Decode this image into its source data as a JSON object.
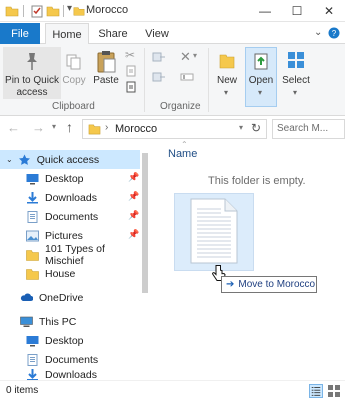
{
  "window": {
    "title": "Morocco",
    "controls": {
      "minimize": "—",
      "maximize": "☐",
      "close": "✕"
    }
  },
  "ribbon_tabs": [
    {
      "label": "File"
    },
    {
      "label": "Home"
    },
    {
      "label": "Share"
    },
    {
      "label": "View"
    }
  ],
  "ribbon": {
    "clipboard": {
      "pin_label_1": "Pin to Quick",
      "pin_label_2": "access",
      "copy_label": "Copy",
      "paste_label": "Paste",
      "group_label": "Clipboard"
    },
    "organize": {
      "group_label": "Organize"
    },
    "new_label": "New",
    "open_label": "Open",
    "select_label": "Select"
  },
  "navbar": {
    "address": "Morocco",
    "search_placeholder": "Search M..."
  },
  "nav_pane": {
    "quick_access": "Quick access",
    "items": [
      {
        "label": "Desktop",
        "icon": "desktop-icon",
        "pinned": true
      },
      {
        "label": "Downloads",
        "icon": "download-icon",
        "pinned": true
      },
      {
        "label": "Documents",
        "icon": "documents-icon",
        "pinned": true
      },
      {
        "label": "Pictures",
        "icon": "pictures-icon",
        "pinned": true
      },
      {
        "label": "101 Types of Mischief",
        "icon": "folder-icon",
        "pinned": false
      },
      {
        "label": "House",
        "icon": "folder-icon",
        "pinned": false
      }
    ],
    "onedrive": "OneDrive",
    "this_pc": "This PC",
    "pc_items": [
      {
        "label": "Desktop",
        "icon": "desktop-icon"
      },
      {
        "label": "Documents",
        "icon": "documents-icon"
      },
      {
        "label": "Downloads",
        "icon": "download-icon"
      }
    ]
  },
  "content": {
    "column_name": "Name",
    "empty_message": "This folder is empty.",
    "drag_tooltip": "Move to Morocco"
  },
  "status": {
    "item_count": "0 items"
  },
  "colors": {
    "accent": "#1979ca",
    "folder": "#f5c84c",
    "selected": "#cce8ff"
  }
}
